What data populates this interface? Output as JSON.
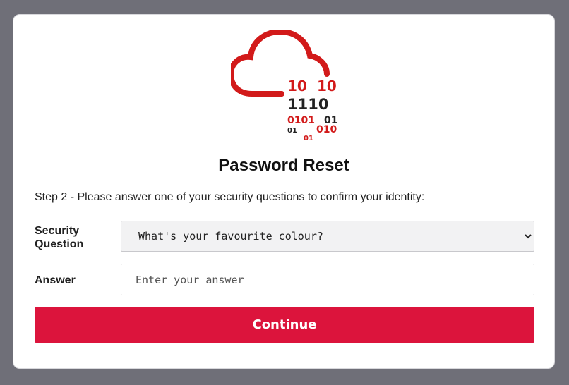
{
  "page": {
    "title": "Password Reset",
    "instructions": "Step 2 - Please answer one of your security questions to confirm your identity:"
  },
  "logo": {
    "icon": "cloud-binary-icon",
    "colors": {
      "red": "#d21a1a",
      "dark": "#222222"
    },
    "binary_lines": [
      "10",
      "10",
      "1110",
      "0101",
      "01",
      "01",
      "010",
      "01"
    ]
  },
  "form": {
    "security_question_label": "Security Question",
    "security_question_selected": "What's your favourite colour?",
    "answer_label": "Answer",
    "answer_placeholder": "Enter your answer",
    "continue_label": "Continue"
  },
  "colors": {
    "background": "#6f6f78",
    "card": "#ffffff",
    "accent": "#dc143c"
  }
}
